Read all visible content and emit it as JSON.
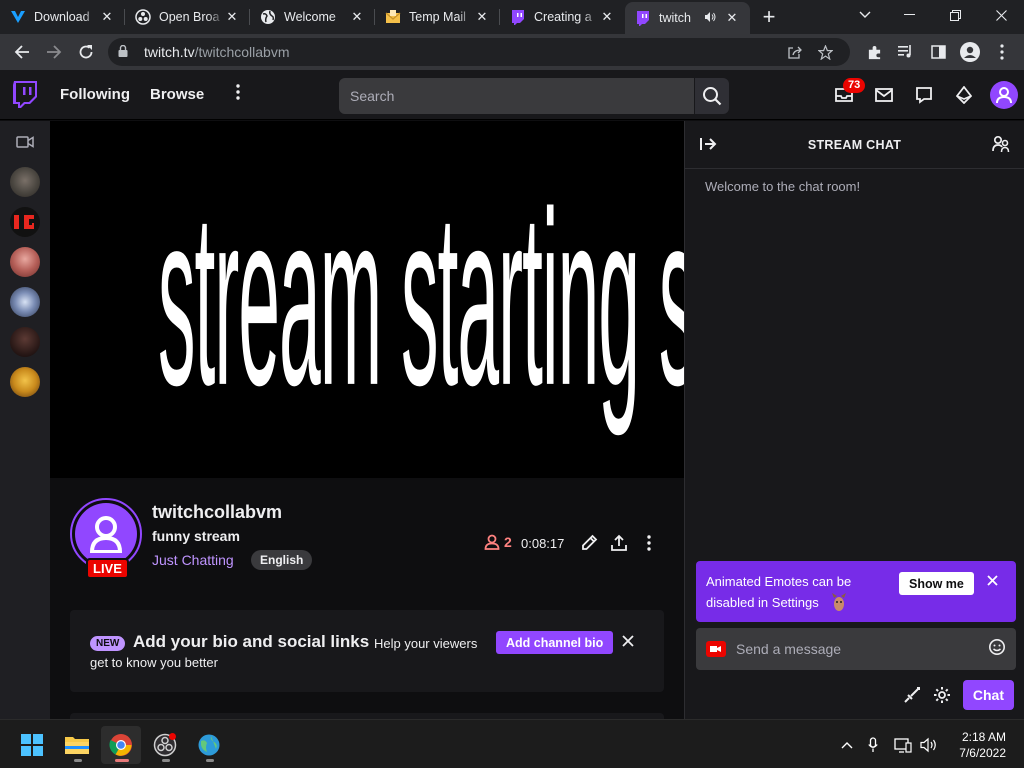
{
  "browser": {
    "tabs": [
      {
        "title": "Download",
        "icon": "tab-download-favicon"
      },
      {
        "title": "Open Broa",
        "icon": "obs-favicon"
      },
      {
        "title": "Welcome",
        "icon": "globe-favicon"
      },
      {
        "title": "Temp Mail",
        "icon": "mail-favicon"
      },
      {
        "title": "Creating a",
        "icon": "twitch-favicon"
      },
      {
        "title": "twitch",
        "icon": "twitch-favicon",
        "active": true,
        "audio": true
      }
    ],
    "url_host": "twitch.tv",
    "url_path": "/twitchcollabvm"
  },
  "twitch_nav": {
    "following": "Following",
    "browse": "Browse",
    "search_placeholder": "Search",
    "inbox_badge": "73"
  },
  "video": {
    "overlay_text": "stream starting soon"
  },
  "channel": {
    "name": "twitchcollabvm",
    "stream_title": "funny stream",
    "category": "Just Chatting",
    "tag": "English",
    "live_label": "LIVE",
    "viewer_count": "2",
    "uptime": "0:08:17"
  },
  "bio_card": {
    "new_label": "NEW",
    "heading": "Add your bio and social links",
    "help_line1": "Help your viewers",
    "help_line2": "get to know you better",
    "button": "Add channel bio"
  },
  "chat": {
    "header": "STREAM CHAT",
    "welcome": "Welcome to the chat room!",
    "promo_text": "Animated Emotes can be disabled in Settings",
    "promo_button": "Show me",
    "input_placeholder": "Send a message",
    "send_button": "Chat"
  },
  "taskbar": {
    "time": "2:18 AM",
    "date": "7/6/2022"
  },
  "colors": {
    "twitch_purple": "#9147ff",
    "live_red": "#eb0400",
    "background": "#0e0e10"
  }
}
